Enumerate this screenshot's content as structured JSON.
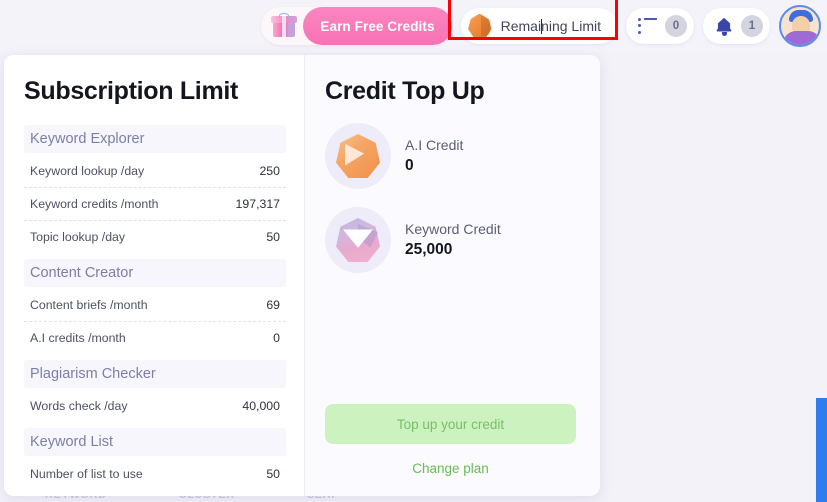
{
  "topbar": {
    "gift_icon": "gift-box-icon",
    "earn_free_credits_label": "Earn Free Credits",
    "remaining_limit": {
      "icon": "orange-gem-icon",
      "label_before_caret": "Remai",
      "label_after_caret": "ning Limit",
      "full_label": "Remaining Limit",
      "highlight_color": "#fb0000"
    },
    "list_pill": {
      "icon": "list-icon",
      "count": "0"
    },
    "bell_pill": {
      "icon": "bell-icon",
      "count": "1"
    },
    "avatar": "user-avatar"
  },
  "subscription": {
    "title": "Subscription Limit",
    "sections": [
      {
        "name": "Keyword Explorer",
        "rows": [
          {
            "label": "Keyword lookup /day",
            "value": "250"
          },
          {
            "label": "Keyword credits /month",
            "value": "197,317"
          },
          {
            "label": "Topic lookup /day",
            "value": "50"
          }
        ]
      },
      {
        "name": "Content Creator",
        "rows": [
          {
            "label": "Content briefs /month",
            "value": "69"
          },
          {
            "label": "A.I credits /month",
            "value": "0"
          }
        ]
      },
      {
        "name": "Plagiarism Checker",
        "rows": [
          {
            "label": "Words check /day",
            "value": "40,000"
          }
        ]
      },
      {
        "name": "Keyword List",
        "rows": [
          {
            "label": "Number of list to use",
            "value": "50"
          }
        ]
      }
    ]
  },
  "topup": {
    "title": "Credit Top Up",
    "credits": [
      {
        "icon": "ai-credit-gem-icon",
        "label": "A.I Credit",
        "value": "0"
      },
      {
        "icon": "keyword-credit-gem-icon",
        "label": "Keyword Credit",
        "value": "25,000"
      }
    ],
    "topup_button_label": "Top up your credit",
    "change_plan_label": "Change plan",
    "button_color": "#ccf2c0",
    "button_text_color": "#79bf66"
  },
  "background": {
    "obscured_labels": [
      "KEYWORD",
      "CLUSTER",
      "SERP"
    ]
  }
}
